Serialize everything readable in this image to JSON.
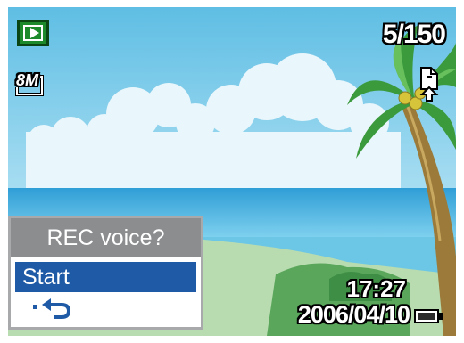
{
  "status": {
    "mode_icon": "playback-icon",
    "counter": "5/150",
    "resolution_label": "8M",
    "rotate_icon": "rotate-icon",
    "time": "17:27",
    "date": "2006/04/10",
    "battery_icon": "battery-full-icon"
  },
  "menu": {
    "title": "REC voice?",
    "items": [
      {
        "label": "Start",
        "selected": true
      },
      {
        "label": "",
        "icon": "return-icon",
        "selected": false
      }
    ]
  },
  "colors": {
    "menu_selected": "#1f5aa6",
    "menu_header": "#8b8d8f",
    "mode_badge": "#1c8a2a"
  }
}
